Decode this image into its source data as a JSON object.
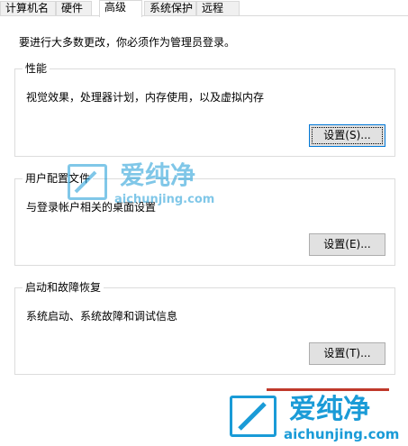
{
  "tabs": [
    {
      "label": "计算机名",
      "active": false
    },
    {
      "label": "硬件",
      "active": false
    },
    {
      "label": "高级",
      "active": true
    },
    {
      "label": "系统保护",
      "active": false
    },
    {
      "label": "远程",
      "active": false
    }
  ],
  "intro_text": "要进行大多数更改，你必须作为管理员登录。",
  "groups": {
    "performance": {
      "title": "性能",
      "description": "视觉效果，处理器计划，内存使用，以及虚拟内存",
      "button_label": "设置(S)..."
    },
    "user_profiles": {
      "title": "用户配置文件",
      "description": "与登录帐户相关的桌面设置",
      "button_label": "设置(E)..."
    },
    "startup_recovery": {
      "title": "启动和故障恢复",
      "description": "系统启动、系统故障和调试信息",
      "button_label": "设置(T)..."
    }
  },
  "watermark": {
    "brand": "爱纯净",
    "url": "aichunjing.com",
    "color": "#1a9bd7"
  },
  "colors": {
    "border": "#dcdcdc",
    "button_bg": "#e1e1e1",
    "focus_border": "#0078d7",
    "highlight_line": "#c0392b"
  }
}
